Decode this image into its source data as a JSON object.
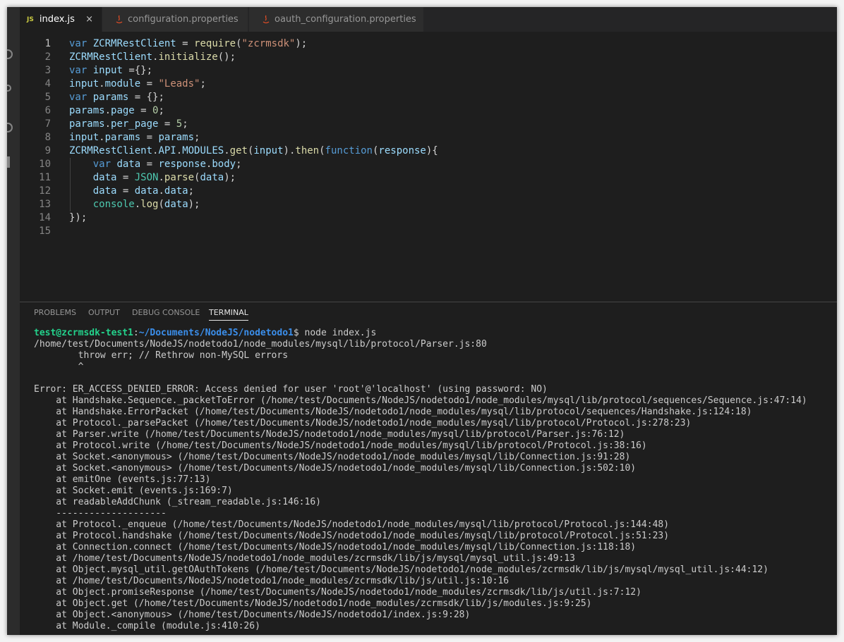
{
  "tabs": [
    {
      "badge": "JS",
      "label": "index.js",
      "active": true
    },
    {
      "label": "configuration.properties",
      "active": false
    },
    {
      "label": "oauth_configuration.properties",
      "active": false
    }
  ],
  "tab_close_glyph": "×",
  "editor": {
    "current_line": 1,
    "lines": [
      {
        "n": "1",
        "tokens": [
          [
            "k",
            "var"
          ],
          [
            "p",
            " "
          ],
          [
            "v",
            "ZCRMRestClient"
          ],
          [
            "p",
            " = "
          ],
          [
            "f",
            "require"
          ],
          [
            "p",
            "("
          ],
          [
            "s",
            "\"zcrmsdk\""
          ],
          [
            "p",
            ");"
          ]
        ]
      },
      {
        "n": "2",
        "tokens": [
          [
            "v",
            "ZCRMRestClient"
          ],
          [
            "p",
            "."
          ],
          [
            "f",
            "initialize"
          ],
          [
            "p",
            "();"
          ]
        ]
      },
      {
        "n": "3",
        "tokens": [
          [
            "k",
            "var"
          ],
          [
            "p",
            " "
          ],
          [
            "v",
            "input"
          ],
          [
            "p",
            " ={};"
          ]
        ]
      },
      {
        "n": "4",
        "tokens": [
          [
            "v",
            "input"
          ],
          [
            "p",
            "."
          ],
          [
            "v",
            "module"
          ],
          [
            "p",
            " = "
          ],
          [
            "s",
            "\"Leads\""
          ],
          [
            "p",
            ";"
          ]
        ]
      },
      {
        "n": "5",
        "tokens": [
          [
            "k",
            "var"
          ],
          [
            "p",
            " "
          ],
          [
            "v",
            "params"
          ],
          [
            "p",
            " = {};"
          ]
        ]
      },
      {
        "n": "6",
        "tokens": [
          [
            "v",
            "params"
          ],
          [
            "p",
            "."
          ],
          [
            "v",
            "page"
          ],
          [
            "p",
            " = "
          ],
          [
            "n",
            "0"
          ],
          [
            "p",
            ";"
          ]
        ]
      },
      {
        "n": "7",
        "tokens": [
          [
            "v",
            "params"
          ],
          [
            "p",
            "."
          ],
          [
            "v",
            "per_page"
          ],
          [
            "p",
            " = "
          ],
          [
            "n",
            "5"
          ],
          [
            "p",
            ";"
          ]
        ]
      },
      {
        "n": "8",
        "tokens": [
          [
            "v",
            "input"
          ],
          [
            "p",
            "."
          ],
          [
            "v",
            "params"
          ],
          [
            "p",
            " = "
          ],
          [
            "v",
            "params"
          ],
          [
            "p",
            ";"
          ]
        ]
      },
      {
        "n": "9",
        "tokens": [
          [
            "v",
            "ZCRMRestClient"
          ],
          [
            "p",
            "."
          ],
          [
            "v",
            "API"
          ],
          [
            "p",
            "."
          ],
          [
            "v",
            "MODULES"
          ],
          [
            "p",
            "."
          ],
          [
            "f",
            "get"
          ],
          [
            "p",
            "("
          ],
          [
            "v",
            "input"
          ],
          [
            "p",
            ")."
          ],
          [
            "f",
            "then"
          ],
          [
            "p",
            "("
          ],
          [
            "k",
            "function"
          ],
          [
            "p",
            "("
          ],
          [
            "v",
            "response"
          ],
          [
            "p",
            "){"
          ]
        ]
      },
      {
        "n": "10",
        "tokens": [
          [
            "p",
            "    "
          ],
          [
            "k",
            "var"
          ],
          [
            "p",
            " "
          ],
          [
            "v",
            "data"
          ],
          [
            "p",
            " = "
          ],
          [
            "v",
            "response"
          ],
          [
            "p",
            "."
          ],
          [
            "v",
            "body"
          ],
          [
            "p",
            ";"
          ]
        ]
      },
      {
        "n": "11",
        "tokens": [
          [
            "p",
            "    "
          ],
          [
            "v",
            "data"
          ],
          [
            "p",
            " = "
          ],
          [
            "t",
            "JSON"
          ],
          [
            "p",
            "."
          ],
          [
            "f",
            "parse"
          ],
          [
            "p",
            "("
          ],
          [
            "v",
            "data"
          ],
          [
            "p",
            ");"
          ]
        ]
      },
      {
        "n": "12",
        "tokens": [
          [
            "p",
            "    "
          ],
          [
            "v",
            "data"
          ],
          [
            "p",
            " = "
          ],
          [
            "v",
            "data"
          ],
          [
            "p",
            "."
          ],
          [
            "v",
            "data"
          ],
          [
            "p",
            ";"
          ]
        ]
      },
      {
        "n": "13",
        "tokens": [
          [
            "p",
            "    "
          ],
          [
            "t",
            "console"
          ],
          [
            "p",
            "."
          ],
          [
            "f",
            "log"
          ],
          [
            "p",
            "("
          ],
          [
            "v",
            "data"
          ],
          [
            "p",
            ");"
          ]
        ]
      },
      {
        "n": "14",
        "tokens": [
          [
            "p",
            "});"
          ]
        ]
      },
      {
        "n": "15",
        "tokens": []
      }
    ]
  },
  "panel": {
    "tabs": [
      {
        "label": "PROBLEMS",
        "active": false
      },
      {
        "label": "OUTPUT",
        "active": false
      },
      {
        "label": "DEBUG CONSOLE",
        "active": false
      },
      {
        "label": "TERMINAL",
        "active": true
      }
    ]
  },
  "terminal": {
    "prompt_user": "test@zcrmsdk-test1",
    "prompt_colon": ":",
    "prompt_path": "~/Documents/NodeJS/nodetodo1",
    "prompt_cmd": "$ node index.js",
    "lines": [
      "/home/test/Documents/NodeJS/nodetodo1/node_modules/mysql/lib/protocol/Parser.js:80",
      "        throw err; // Rethrow non-MySQL errors",
      "        ^",
      "",
      "Error: ER_ACCESS_DENIED_ERROR: Access denied for user 'root'@'localhost' (using password: NO)",
      "    at Handshake.Sequence._packetToError (/home/test/Documents/NodeJS/nodetodo1/node_modules/mysql/lib/protocol/sequences/Sequence.js:47:14)",
      "    at Handshake.ErrorPacket (/home/test/Documents/NodeJS/nodetodo1/node_modules/mysql/lib/protocol/sequences/Handshake.js:124:18)",
      "    at Protocol._parsePacket (/home/test/Documents/NodeJS/nodetodo1/node_modules/mysql/lib/protocol/Protocol.js:278:23)",
      "    at Parser.write (/home/test/Documents/NodeJS/nodetodo1/node_modules/mysql/lib/protocol/Parser.js:76:12)",
      "    at Protocol.write (/home/test/Documents/NodeJS/nodetodo1/node_modules/mysql/lib/protocol/Protocol.js:38:16)",
      "    at Socket.<anonymous> (/home/test/Documents/NodeJS/nodetodo1/node_modules/mysql/lib/Connection.js:91:28)",
      "    at Socket.<anonymous> (/home/test/Documents/NodeJS/nodetodo1/node_modules/mysql/lib/Connection.js:502:10)",
      "    at emitOne (events.js:77:13)",
      "    at Socket.emit (events.js:169:7)",
      "    at readableAddChunk (_stream_readable.js:146:16)",
      "    --------------------",
      "    at Protocol._enqueue (/home/test/Documents/NodeJS/nodetodo1/node_modules/mysql/lib/protocol/Protocol.js:144:48)",
      "    at Protocol.handshake (/home/test/Documents/NodeJS/nodetodo1/node_modules/mysql/lib/protocol/Protocol.js:51:23)",
      "    at Connection.connect (/home/test/Documents/NodeJS/nodetodo1/node_modules/mysql/lib/Connection.js:118:18)",
      "    at /home/test/Documents/NodeJS/nodetodo1/node_modules/zcrmsdk/lib/js/mysql/mysql_util.js:49:13",
      "    at Object.mysql_util.getOAuthTokens (/home/test/Documents/NodeJS/nodetodo1/node_modules/zcrmsdk/lib/js/mysql/mysql_util.js:44:12)",
      "    at /home/test/Documents/NodeJS/nodetodo1/node_modules/zcrmsdk/lib/js/util.js:10:16",
      "    at Object.promiseResponse (/home/test/Documents/NodeJS/nodetodo1/node_modules/zcrmsdk/lib/js/util.js:7:12)",
      "    at Object.get (/home/test/Documents/NodeJS/nodetodo1/node_modules/zcrmsdk/lib/js/modules.js:9:25)",
      "    at Object.<anonymous> (/home/test/Documents/NodeJS/nodetodo1/index.js:9:28)",
      "    at Module._compile (module.js:410:26)"
    ]
  },
  "colors": {
    "editor_bg": "#1e1e1e",
    "keyword": "#569cd6",
    "variable": "#9cdcfe",
    "function": "#dcdcaa",
    "string": "#ce9178",
    "number": "#b5cea8",
    "type": "#4ec9b0",
    "prompt_user": "#23d18b",
    "prompt_path": "#3b8eea"
  }
}
